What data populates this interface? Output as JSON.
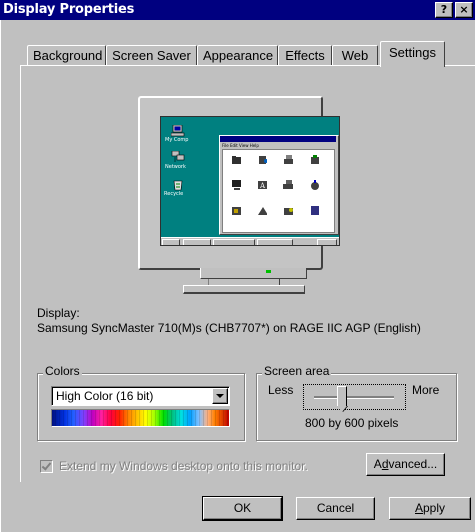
{
  "window": {
    "title": "Display Properties",
    "help_button": "?",
    "close_button": "×"
  },
  "tabs": [
    {
      "label": "Background",
      "active": false
    },
    {
      "label": "Screen Saver",
      "active": false
    },
    {
      "label": "Appearance",
      "active": false
    },
    {
      "label": "Effects",
      "active": false
    },
    {
      "label": "Web",
      "active": false
    },
    {
      "label": "Settings",
      "active": true
    }
  ],
  "display": {
    "label": "Display:",
    "device": "Samsung SyncMaster 710(M)s (CHB7707*) on RAGE IIC AGP (English)"
  },
  "colors": {
    "group_label": "Colors",
    "selected": "High Color (16 bit)"
  },
  "screen_area": {
    "group_label": "Screen area",
    "less_label": "Less",
    "more_label": "More",
    "resolution": "800 by 600 pixels",
    "slider_level": 0.35
  },
  "extend_desktop": {
    "label": "Extend my Windows desktop onto this monitor.",
    "checked": true,
    "enabled": false
  },
  "buttons": {
    "advanced": "Advanced...",
    "ok": "OK",
    "cancel": "Cancel",
    "apply": "Apply"
  },
  "theme_colors": {
    "title_bar": "#000080",
    "face": "#c0c0c0",
    "desktop": "#008080"
  }
}
